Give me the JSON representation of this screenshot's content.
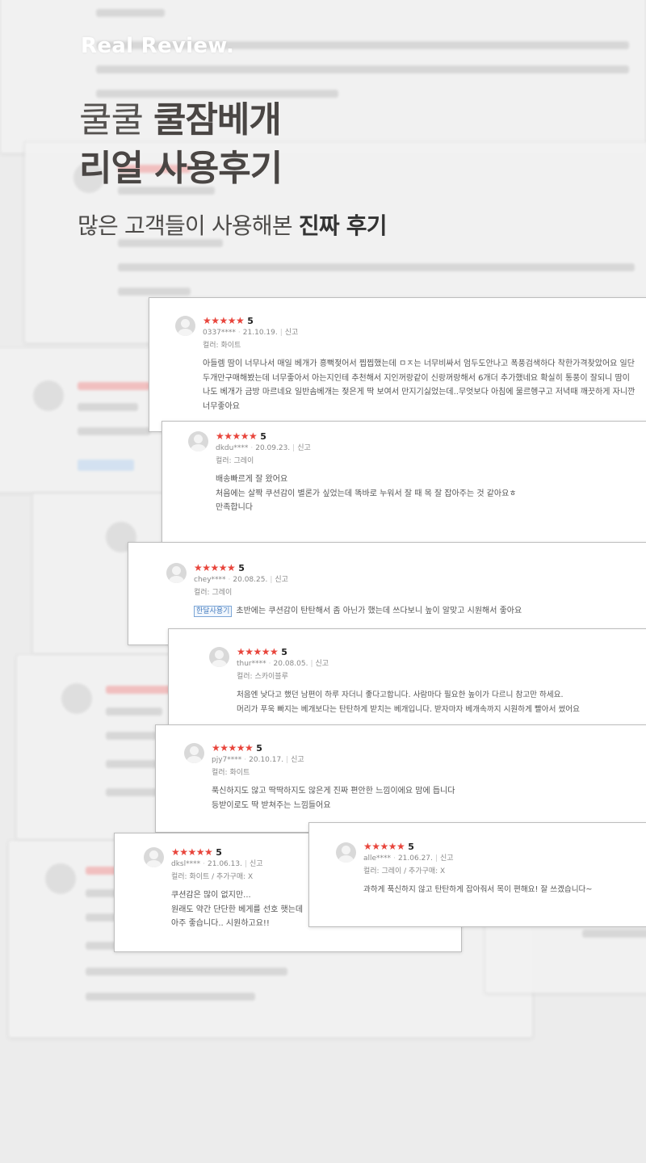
{
  "header": {
    "brand": "Real Review.",
    "title_line1_light": "쿨쿨",
    "title_line1_bold": "쿨잠베개",
    "title_line2": "리얼 사용후기",
    "subtitle_light": "많은 고객들이 사용해본",
    "subtitle_bold": "진짜 후기"
  },
  "icons": {
    "avatar": "user-avatar-icon",
    "star": "star-icon"
  },
  "colors": {
    "star": "#e8453c",
    "badge": "#4a7fc0",
    "background": "#ececec"
  },
  "reviews": [
    {
      "stars": "★★★★★",
      "score": "5",
      "user": "0337****",
      "date": "21.10.19.",
      "report": "신고",
      "option": "컬러: 화이트",
      "lines": [
        "아들렘 땀이 너무나서 매일 베개가 흥뻑젖어서 찝찝했는데 ㅁㅈ는 너무비싸서 엄두도안나고 폭풍검색하다 착한가격찾았어요 일단 두개만구매해봤는데 너무좋아서 아는지인테 추천해서  지인꺼랑같이 신랑꺼랑해서 6개더 추가했네요 확실히 통풍이 잘되니 땀이 나도 베개가 금방 마르네요 일반솜베개는 젖은게 딱 보여서 만지기싫었는데..무엇보다 아침에 물르헹구고 저녁때 깨끗하게 자니깐 너무좋아요"
      ]
    },
    {
      "stars": "★★★★★",
      "score": "5",
      "user": "dkdu****",
      "date": "20.09.23.",
      "report": "신고",
      "option": "컬러: 그레이",
      "lines": [
        "배송빠르게 잘 왔어요",
        "처음에는 살짝 쿠션감이 별론가 싶었는데 똑바로 누워서 잘 때 목 잘 잡아주는 것 같아요ㅎ",
        "만족합니다"
      ]
    },
    {
      "stars": "★★★★★",
      "score": "5",
      "user": "chey****",
      "date": "20.08.25.",
      "report": "신고",
      "option": "컬러: 그레이",
      "badge": "한달사용기",
      "lines": [
        "초반에는 쿠션감이 탄탄해서 좀 아닌가 했는데 쓰다보니 높이 알맞고 시원해서 좋아요"
      ]
    },
    {
      "stars": "★★★★★",
      "score": "5",
      "user": "thur****",
      "date": "20.08.05.",
      "report": "신고",
      "option": "컬러: 스카이블루",
      "lines": [
        "처음엔  낮다고 했던 남편이 하루 자더니 좋다고합니다. 사람마다 필요한 높이가 다르니 참고만 하세요.",
        "머리가 푸욱 빠지는 베개보다는 탄탄하게 받치는 베개입니다. 받자마자 베개속까지 시원하게  빨아서 썼어요"
      ]
    },
    {
      "stars": "★★★★★",
      "score": "5",
      "user": "pjy7****",
      "date": "20.10.17.",
      "report": "신고",
      "option": "컬러: 화이트",
      "lines": [
        "푹신하지도 않고 딱딱하지도 않은게 진짜 편안한 느낌이에요 맘에 듭니다",
        "등받이로도 딱 받쳐주는 느낌들어요"
      ]
    },
    {
      "stars": "★★★★★",
      "score": "5",
      "user": "dksl****",
      "date": "21.06.13.",
      "report": "신고",
      "option": "컬러: 화이트 / 추가구매: X",
      "lines": [
        "쿠션감은 많이 없지만...",
        "원래도 약간 단단한 베게를 선호 햇는데",
        "아주 좋습니다.. 시원하고요!!"
      ]
    },
    {
      "stars": "★★★★★",
      "score": "5",
      "user": "alle****",
      "date": "21.06.27.",
      "report": "신고",
      "option": "컬러: 그레이 / 추가구매: X",
      "lines": [
        "과하게 푹신하지 않고 탄탄하게 잡아줘서 목이 편해요! 잘 쓰겠습니다~"
      ]
    }
  ]
}
